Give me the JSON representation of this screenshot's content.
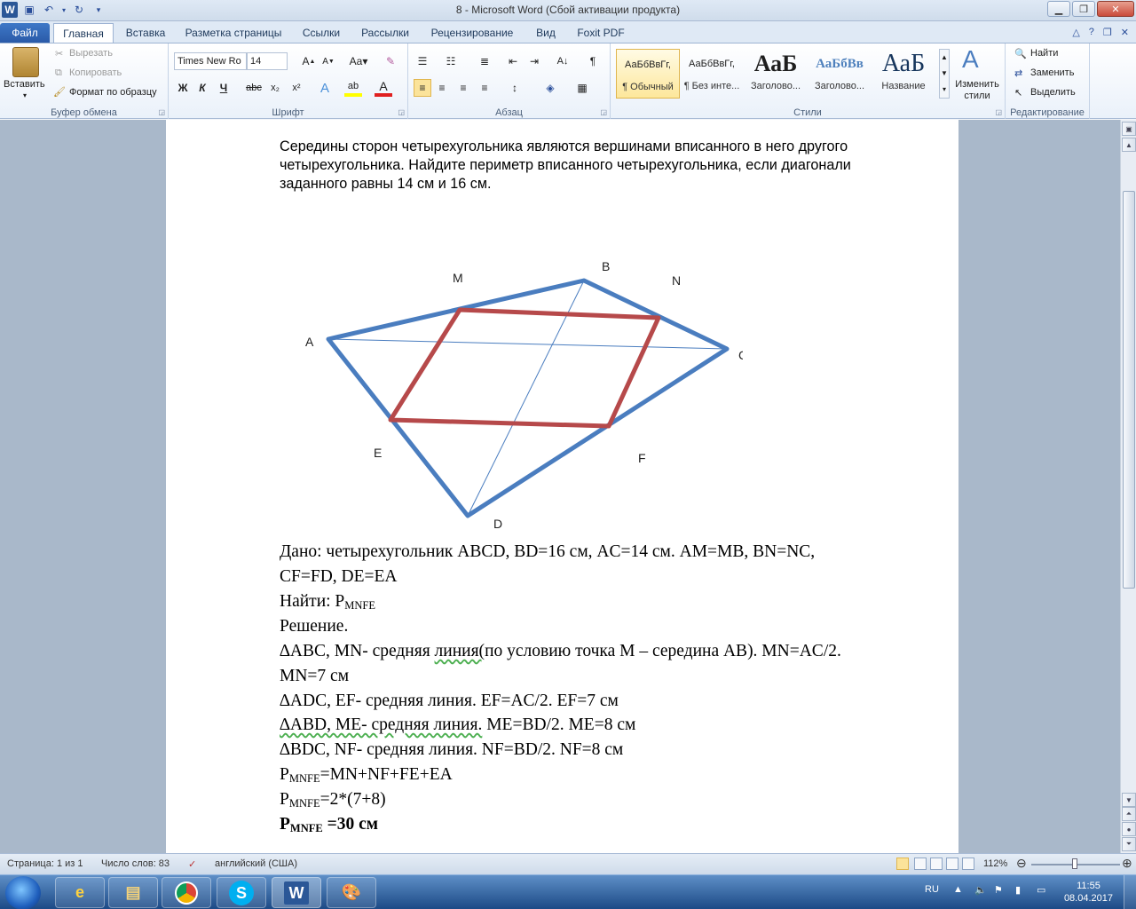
{
  "window": {
    "title": "8  -  Microsoft Word (Сбой активации продукта)"
  },
  "tabs": [
    {
      "label": "Файл"
    },
    {
      "label": "Главная"
    },
    {
      "label": "Вставка"
    },
    {
      "label": "Разметка страницы"
    },
    {
      "label": "Ссылки"
    },
    {
      "label": "Рассылки"
    },
    {
      "label": "Рецензирование"
    },
    {
      "label": "Вид"
    },
    {
      "label": "Foxit PDF"
    }
  ],
  "ribbon": {
    "clipboard": {
      "label": "Буфер обмена",
      "paste": "Вставить",
      "cut": "Вырезать",
      "copy": "Копировать",
      "format_painter": "Формат по образцу"
    },
    "font": {
      "label": "Шрифт",
      "font_name": "Times New Ro",
      "font_size": "14"
    },
    "paragraph": {
      "label": "Абзац"
    },
    "styles": {
      "label": "Стили",
      "items": [
        {
          "preview": "АаБбВвГг,",
          "name": "¶ Обычный"
        },
        {
          "preview": "АаБбВвГг,",
          "name": "¶ Без инте..."
        },
        {
          "preview": "АаБ",
          "name": "Заголово..."
        },
        {
          "preview": "АаБбВв",
          "name": "Заголово..."
        },
        {
          "preview": "АаБ",
          "name": "Название"
        }
      ],
      "change_styles": "Изменить стили"
    },
    "editing": {
      "label": "Редактирование",
      "find": "Найти",
      "replace": "Заменить",
      "select": "Выделить"
    }
  },
  "document": {
    "problem": "Середины сторон четырехугольника являются вершинами вписанного в него другого четырехугольника. Найдите периметр вписанного четырехугольника, если диагонали заданного равны 14 см и 16 см.",
    "figure_labels": {
      "A": "A",
      "B": "B",
      "C": "C",
      "D": "D",
      "M": "M",
      "N": "N",
      "E": "E",
      "F": "F"
    },
    "solution": {
      "given_1": "Дано: четырехугольник ABCD, BD=16 см, AC=14 см. AM=MB, BN=NC,",
      "given_2": "CF=FD, DE=EA",
      "find_prefix": "Найти: P",
      "find_sub": "MNFE",
      "solution_label": "Решение.",
      "line1_a": "∆ABC, MN- средняя ",
      "line1_wavy": "линия(",
      "line1_b": "по условию точка М – середина АВ). MN=AC/2.",
      "line2": "MN=7 см",
      "line3": "∆ADC, EF- средняя линия. EF=AC/2. EF=7 см",
      "line4_wavy": "∆ABD, ME- средняя линия.",
      "line4_b": " ME=BD/2. ME=8 см",
      "line5": "∆BDC, NF- средняя линия. NF=BD/2. NF=8 см",
      "p1_sub": "MNFE",
      "p1_rest": "=MN+NF+FE+EA",
      "p2_sub": "MNFE",
      "p2_rest": "=2*(7+8)",
      "p3_sub": "MNFE",
      "p3_rest": " =30 см",
      "p_letter": "P"
    }
  },
  "statusbar": {
    "page": "Страница: 1 из 1",
    "words": "Число слов: 83",
    "language": "английский (США)",
    "zoom": "112%"
  },
  "taskbar": {
    "lang": "RU",
    "time": "11:55",
    "date": "08.04.2017"
  },
  "colors": {
    "quad_outer": "#4a7dbf",
    "quad_inner": "#b6494a",
    "diagonal": "#4a7dbf"
  }
}
